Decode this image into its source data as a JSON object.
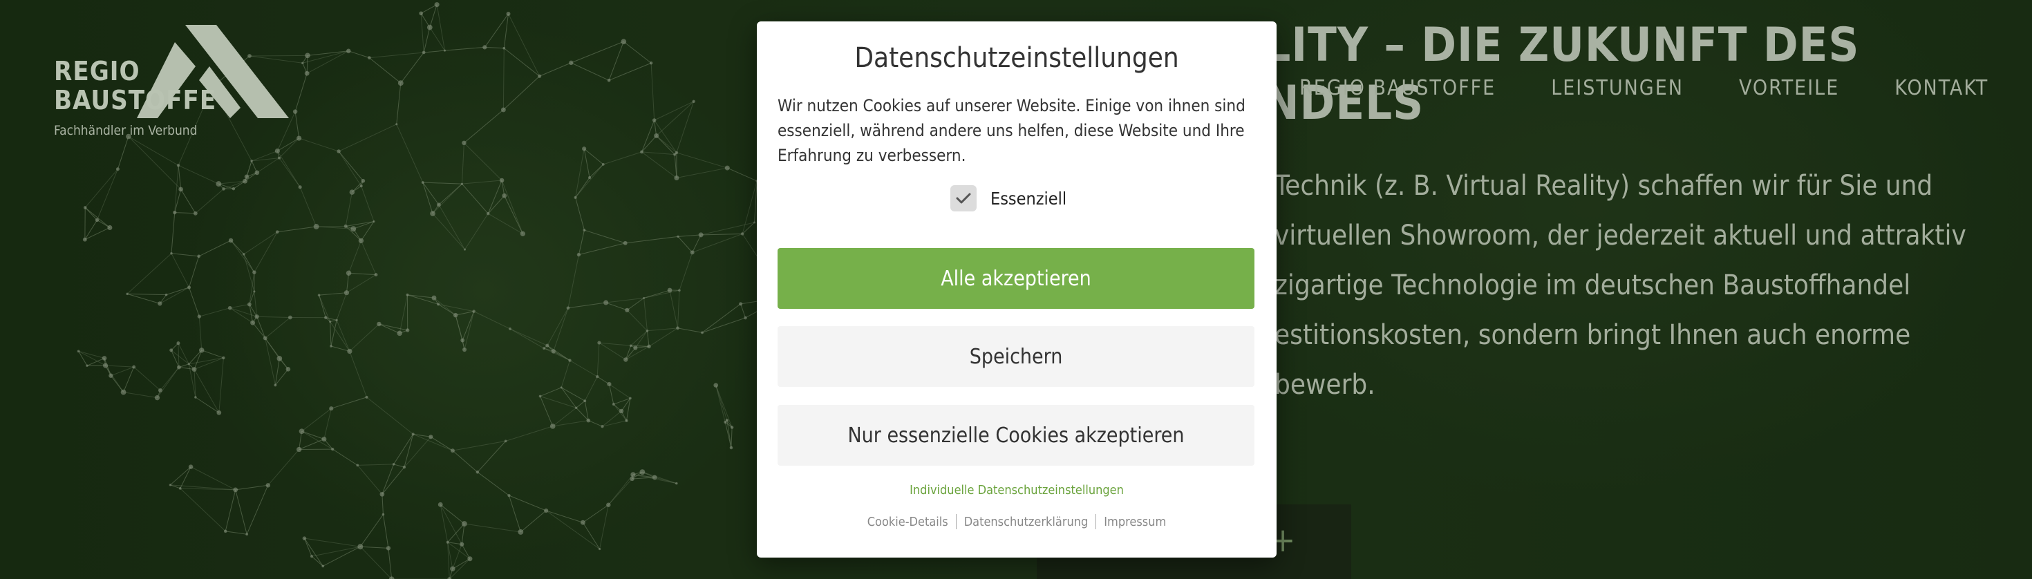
{
  "logo": {
    "line1": "REGIO",
    "line2": "BAUSTOFFE",
    "tagline": "Fachhändler im Verbund"
  },
  "nav": {
    "items": [
      "REGIO BAUSTOFFE",
      "LEISTUNGEN",
      "VORTEILE",
      "KONTAKT"
    ]
  },
  "hero": {
    "title_line1": "ALITY – DIE ZUKUNFT DES",
    "title_line2": "ANDELS",
    "body_lines": [
      "Technik (z. B. Virtual Reality) schaffen wir für Sie und",
      "virtuellen Showroom, der jederzeit aktuell und attraktiv",
      "zigartige Technologie im deutschen Baustoffhandel",
      "estitionskosten, sondern bringt Ihnen auch enorme",
      "bewerb."
    ],
    "button_symbol": "+"
  },
  "consent": {
    "title": "Datenschutzeinstellungen",
    "description": "Wir nutzen Cookies auf unserer Website. Einige von ihnen sind essenziell, während andere uns helfen, diese Website und Ihre Erfahrung zu verbessern.",
    "checkbox_label": "Essenziell",
    "checkbox_checked": true,
    "accept_all_label": "Alle akzeptieren",
    "save_label": "Speichern",
    "essential_only_label": "Nur essenzielle Cookies akzeptieren",
    "individual_link": "Individuelle Datenschutzeinstellungen",
    "footer_links": [
      "Cookie-Details",
      "Datenschutzerklärung",
      "Impressum"
    ]
  },
  "colors": {
    "accent_green": "#76b04a",
    "link_green": "#6aa33c",
    "background_green": "#213819"
  }
}
